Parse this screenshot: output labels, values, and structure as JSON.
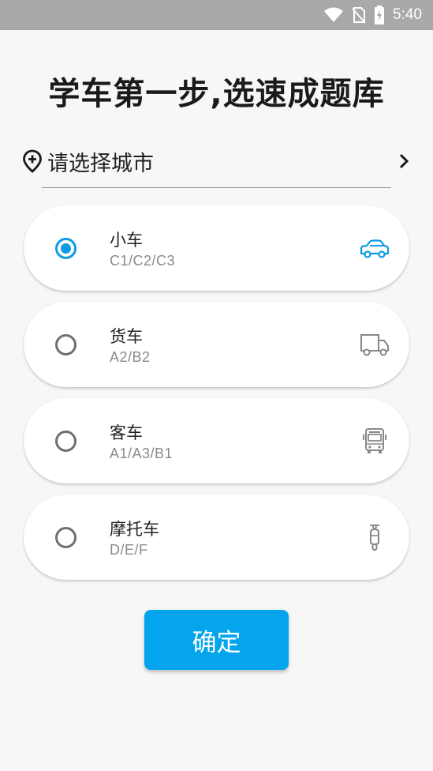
{
  "status_bar": {
    "time": "5:40"
  },
  "title": "学车第一步,选速成题库",
  "city": {
    "label": "请选择城市"
  },
  "options": [
    {
      "name": "小车",
      "codes": "C1/C2/C3",
      "icon": "car-icon",
      "selected": true
    },
    {
      "name": "货车",
      "codes": "A2/B2",
      "icon": "truck-icon",
      "selected": false
    },
    {
      "name": "客车",
      "codes": "A1/A3/B1",
      "icon": "bus-icon",
      "selected": false
    },
    {
      "name": "摩托车",
      "codes": "D/E/F",
      "icon": "scooter-icon",
      "selected": false
    }
  ],
  "confirm_label": "确定",
  "colors": {
    "accent": "#05a5ee",
    "radio_selected": "#0d9be6",
    "status_bar": "#a9a9a9"
  }
}
